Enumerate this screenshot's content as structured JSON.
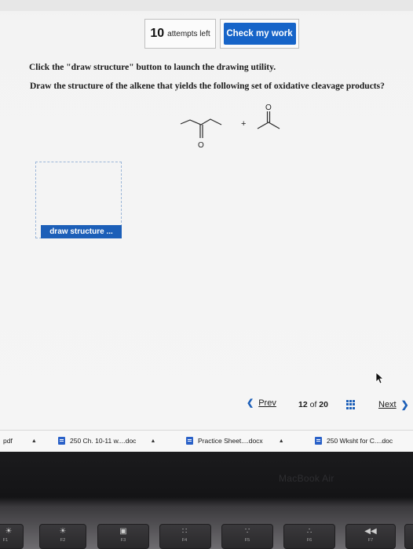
{
  "attempts": {
    "count": "10",
    "label": "attempts left"
  },
  "check_button": "Check my work",
  "instructions": {
    "line1": "Click the \"draw structure\" button to launch the drawing utility.",
    "line2": "Draw the structure of the alkene that yields the following set of oxidative cleavage products?"
  },
  "molecule": {
    "plus": "+",
    "oxygen1": "O",
    "oxygen2": "O"
  },
  "draw_button": "draw structure ...",
  "pagination": {
    "prev": "Prev",
    "current": "12",
    "of": "of",
    "total": "20",
    "next": "Next"
  },
  "downloads": {
    "pdf_label": "pdf",
    "items": [
      {
        "name": "250 Ch. 10-11 w....doc"
      },
      {
        "name": "Practice Sheet....docx"
      },
      {
        "name": "250 Wksht for C....doc"
      }
    ]
  },
  "laptop": {
    "brand": "MacBook Air",
    "keys": [
      {
        "label": "F1"
      },
      {
        "label": "F2"
      },
      {
        "label": "F3"
      },
      {
        "label": "F4"
      },
      {
        "label": "F5"
      },
      {
        "label": "F6"
      },
      {
        "label": "F7"
      }
    ]
  },
  "colors": {
    "accent": "#1664c8",
    "page_bg": "#f5f5f5",
    "bezel": "#1b1b1d"
  }
}
